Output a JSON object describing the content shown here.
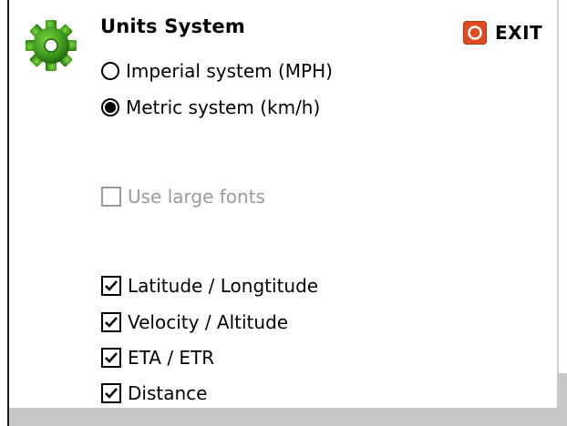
{
  "header": {
    "title": "Units System",
    "exit_label": "EXIT"
  },
  "units": {
    "options": [
      {
        "label": "Imperial system (MPH)",
        "selected": false
      },
      {
        "label": "Metric system (km/h)",
        "selected": true
      }
    ]
  },
  "fonts": {
    "large_fonts_label": "Use large fonts",
    "large_fonts_checked": false,
    "large_fonts_disabled": true
  },
  "display": {
    "items": [
      {
        "label": "Latitude / Longtitude",
        "checked": true
      },
      {
        "label": "Velocity / Altitude",
        "checked": true
      },
      {
        "label": "ETA / ETR",
        "checked": true
      },
      {
        "label": "Distance",
        "checked": true
      }
    ]
  },
  "colors": {
    "gear": "#3f9b1f",
    "exit_icon": "#e24b1f",
    "disabled_text": "#9a9a9a"
  },
  "icons": [
    "gear-icon",
    "power-icon",
    "checkmark-icon"
  ]
}
